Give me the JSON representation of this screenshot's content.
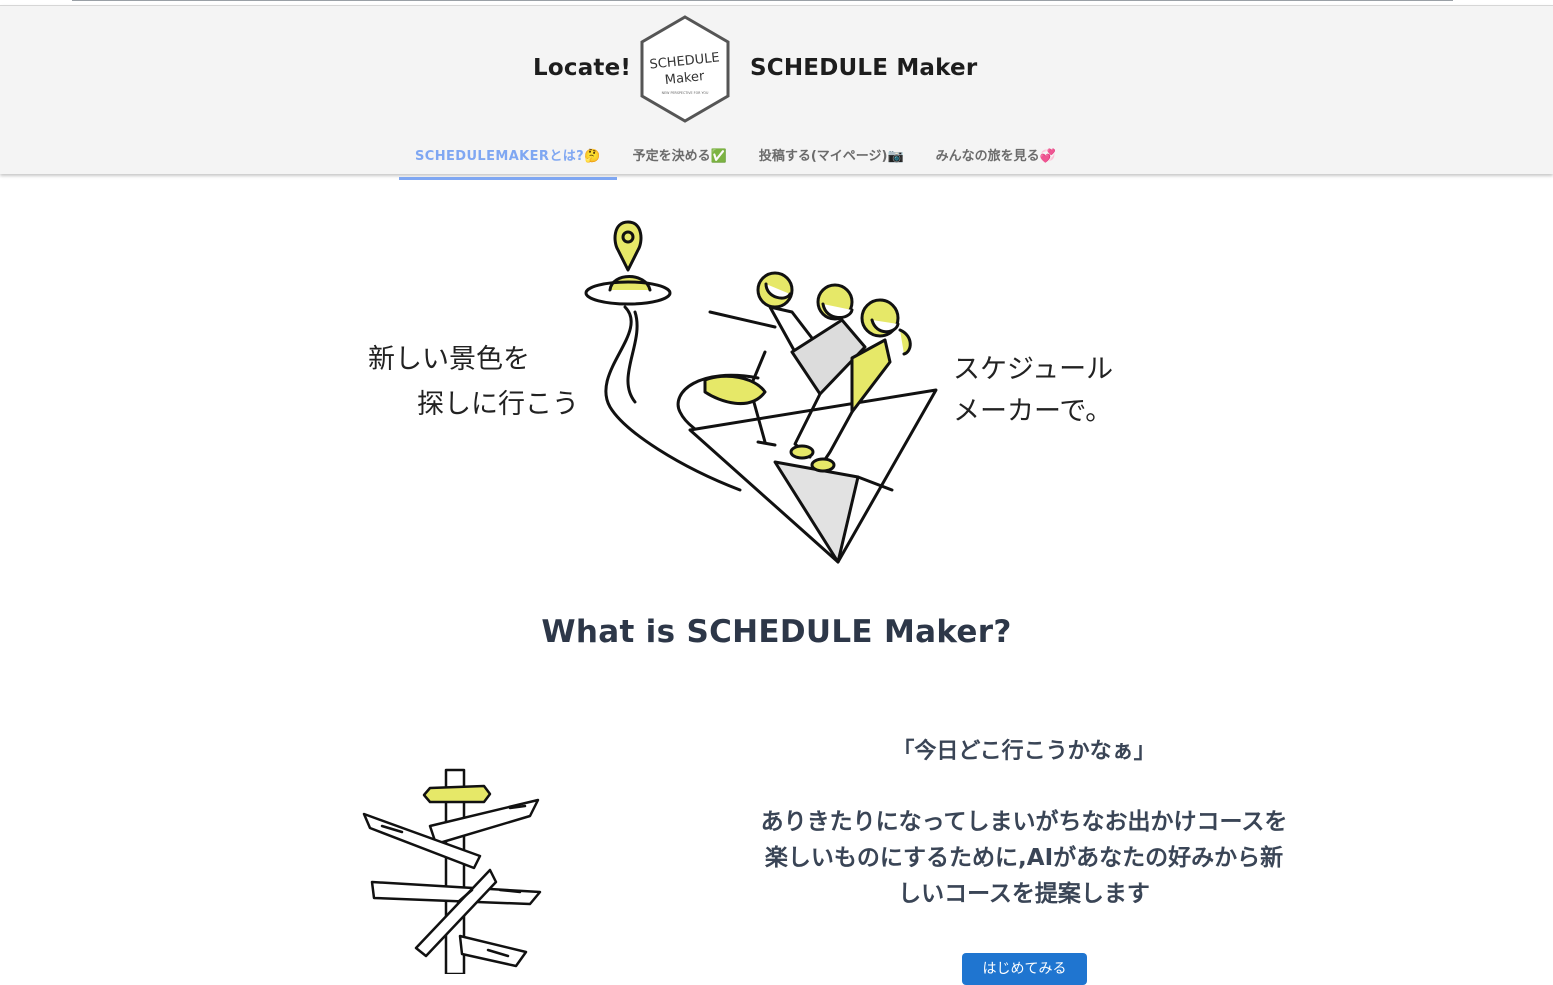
{
  "header": {
    "brand_left": "Locate!",
    "brand_right": "SCHEDULE Maker",
    "logo": {
      "line1": "SCHEDULE",
      "line2": "Maker",
      "tagline": "NEW PERSPECTIVE FOR YOU"
    }
  },
  "nav": {
    "items": [
      {
        "label": "SCHEDULEMAKERとは?🤔",
        "active": true
      },
      {
        "label": "予定を決める✅",
        "active": false
      },
      {
        "label": "投稿する(マイページ)📷",
        "active": false
      },
      {
        "label": "みんなの旅を見る💞",
        "active": false
      }
    ]
  },
  "hero": {
    "left_line1": "新しい景色を",
    "left_line2": "探しに行こう",
    "right_line1": "スケジュール",
    "right_line2": "メーカーで。"
  },
  "about": {
    "title": "What is SCHEDULE Maker?",
    "quote": "「今日どこ行こうかなぁ」",
    "desc_line1": "ありきたりになってしまいがちなお出かけコースを",
    "desc_line2": "楽しいものにするために,AIがあなたの好みから新",
    "desc_line3": "しいコースを提案します",
    "cta": "はじめてみる"
  },
  "colors": {
    "accent": "#7fa7f2",
    "illustration_yellow": "#e6e868",
    "button": "#1f75d0",
    "header_bg": "#f4f4f4"
  }
}
